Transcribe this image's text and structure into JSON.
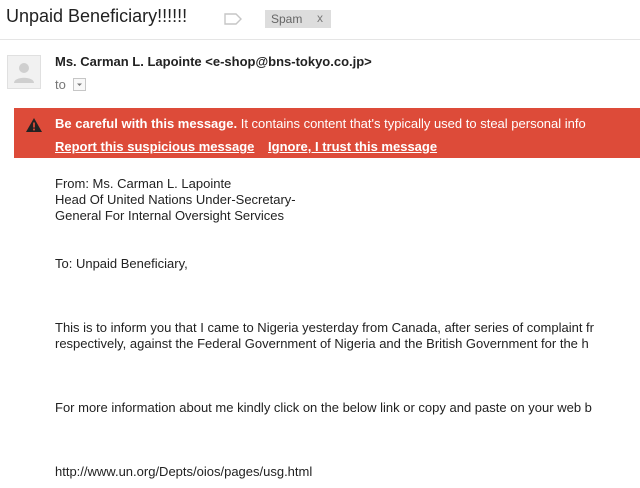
{
  "email": {
    "subject": "Unpaid Beneficiary!!!!!!",
    "label_chip": "Spam",
    "label_chip_close": "x",
    "sender": "Ms. Carman L. Lapointe <e-shop@bns-tokyo.co.jp>",
    "recipient_prefix": "to"
  },
  "warning": {
    "title": "Be careful with this message.",
    "text": "It contains content that's typically used to steal personal info",
    "report_link": "Report this suspicious message",
    "ignore_link": "Ignore, I trust this message",
    "background_color": "#dd4b39"
  },
  "body": {
    "from_lines": [
      "From: Ms. Carman L. Lapointe",
      "Head Of United Nations Under-Secretary-",
      "General For Internal Oversight Services"
    ],
    "to_line": "To: Unpaid Beneficiary,",
    "paragraph1_lines": [
      "This is to inform you that I came to Nigeria yesterday from Canada, after series of complaint fr",
      "respectively, against the Federal Government of Nigeria and the British Government for the h"
    ],
    "paragraph2": "For more information about me kindly click on the below link or copy and paste on your web b",
    "link": "http://www.un.org/Depts/oios/pages/usg.html"
  },
  "icons": {
    "label": "label-icon",
    "avatar": "person-icon",
    "details": "chevron-down-icon",
    "warning": "warning-triangle-icon"
  }
}
